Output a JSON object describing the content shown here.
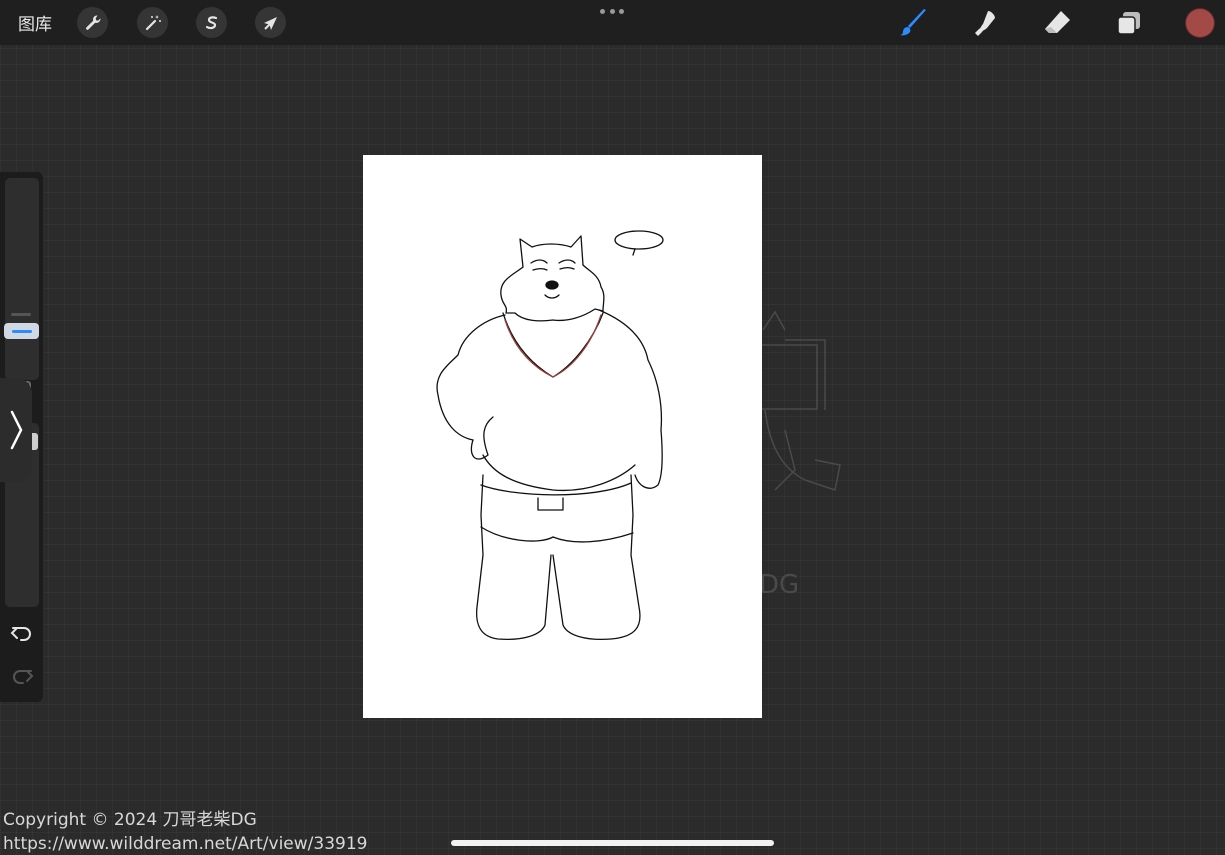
{
  "topbar": {
    "gallery_label": "图库",
    "left_tools": [
      {
        "name": "actions",
        "icon": "wrench-icon"
      },
      {
        "name": "adjustments",
        "icon": "magic-wand-icon"
      },
      {
        "name": "selection",
        "icon": "selection-s-icon"
      },
      {
        "name": "transform",
        "icon": "arrow-cursor-icon"
      }
    ],
    "right_tools": [
      {
        "name": "brush",
        "icon": "brush-icon",
        "active": true
      },
      {
        "name": "smudge",
        "icon": "smudge-finger-icon",
        "active": false
      },
      {
        "name": "eraser",
        "icon": "eraser-icon",
        "active": false
      },
      {
        "name": "layers",
        "icon": "layers-icon",
        "active": false
      }
    ],
    "current_color": "#a34a47"
  },
  "colors": {
    "active_tool": "#2a8cff",
    "toolbar_bg": "#1f1f1f",
    "canvas_bg": "#ffffff"
  },
  "watermark": {
    "line1": "Copyright © 2024 刀哥老柴DG",
    "line2": "https://www.wilddream.net/Art/view/33919"
  },
  "background_text": "DG"
}
